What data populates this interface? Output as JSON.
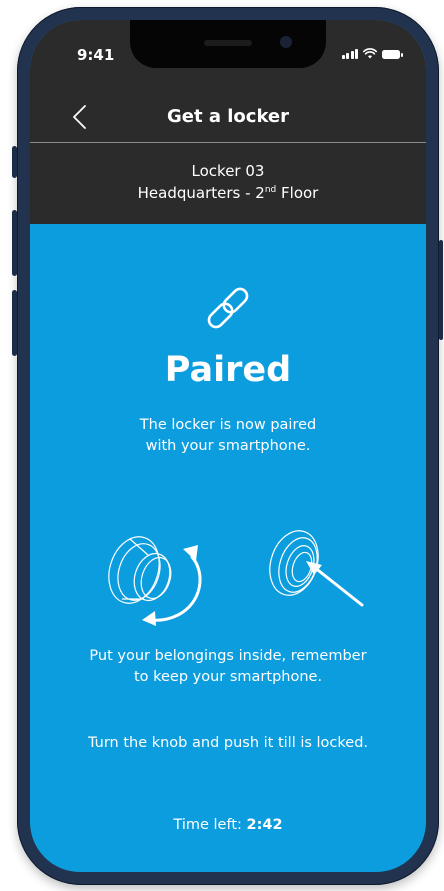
{
  "status_bar": {
    "time": "9:41"
  },
  "header": {
    "title": "Get a locker",
    "back_icon": "chevron-left-icon"
  },
  "locker": {
    "name": "Locker 03",
    "location_prefix": "Headquarters - 2",
    "location_superscript": "nd",
    "location_suffix": " Floor"
  },
  "pairing": {
    "icon": "link-icon",
    "title": "Paired",
    "description": "The locker is now paired with your smartphone."
  },
  "instructions": {
    "belongings": "Put your belongings inside, remember to keep your smartphone.",
    "knob": "Turn the knob and push it till is locked."
  },
  "timer": {
    "label": "Time left: ",
    "value": "2:42"
  },
  "colors": {
    "accent": "#0c9ddf",
    "header_bg": "#2b2b2b",
    "frame": "#22334f",
    "text": "#ffffff"
  }
}
